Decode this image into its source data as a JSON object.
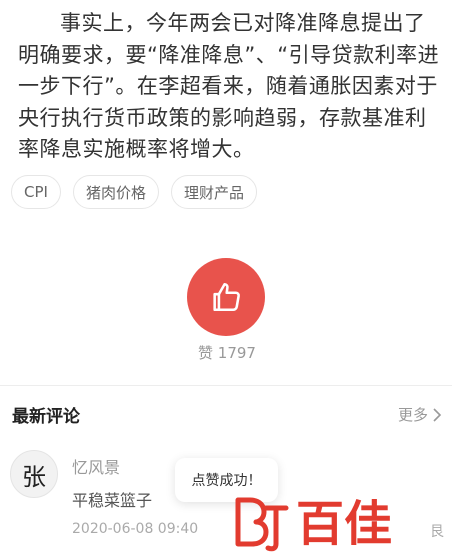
{
  "article": {
    "paragraph": "事实上，今年两会已对降准降息提出了明确要求，要“降准降息”、“引导贷款利率进一步下行”。在李超看来，随着通胀因素对于央行执行货币政策的影响趋弱，存款基准利率降息实施概率将增大。"
  },
  "tags": [
    "CPI",
    "猪肉价格",
    "理财产品"
  ],
  "like": {
    "icon": "thumbs-up-icon",
    "label": "赞 1797",
    "button_color": "#e8534c"
  },
  "comments_section": {
    "title": "最新评论",
    "more_label": "更多"
  },
  "comment": {
    "avatar_char": "张",
    "username": "忆风景",
    "text": "平稳菜篮子",
    "timestamp": "2020-06-08 09:40",
    "trailing_fragment": "艮"
  },
  "toast": {
    "text": "点赞成功！"
  },
  "watermark": {
    "text": "百佳",
    "color": "#e23b2f"
  }
}
